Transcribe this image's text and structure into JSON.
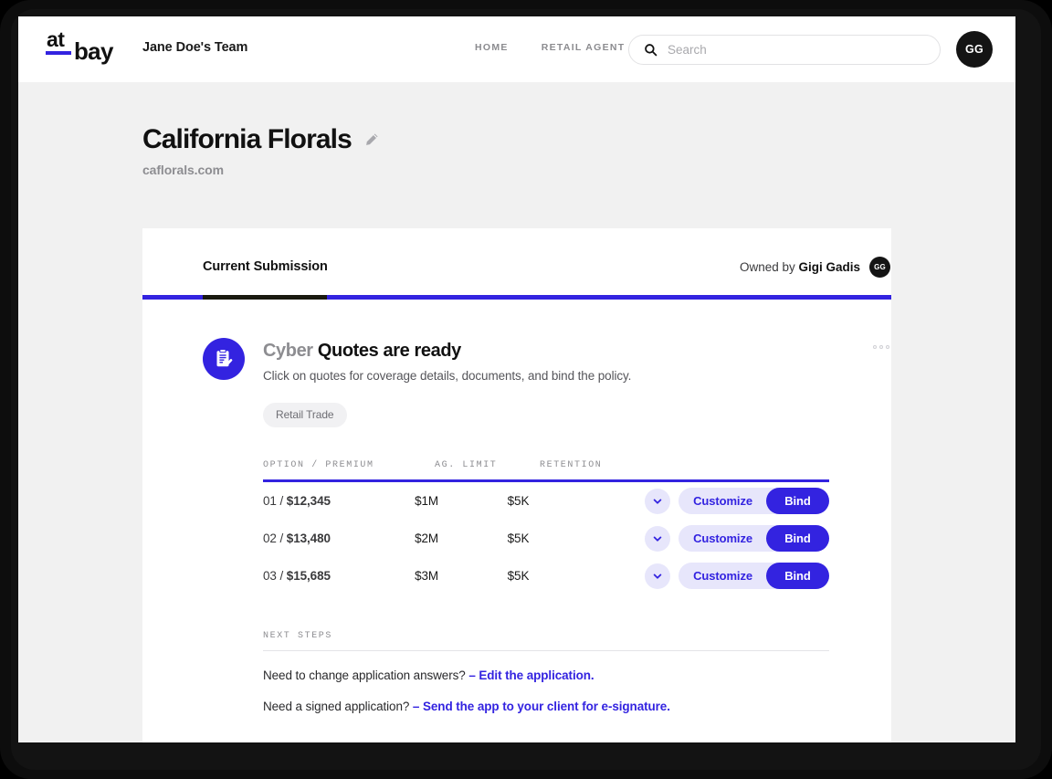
{
  "topbar": {
    "logo": {
      "at": "at",
      "bay": "bay"
    },
    "team_name": "Jane Doe's Team",
    "nav": [
      {
        "label": "HOME"
      },
      {
        "label": "RETAIL AGENT"
      }
    ],
    "search": {
      "placeholder": "Search",
      "value": "",
      "icon": "search-icon"
    },
    "avatar_initials": "GG"
  },
  "page": {
    "title": "California Florals",
    "subtitle": "caflorals.com",
    "edit_icon": "pencil-icon"
  },
  "card": {
    "tab_label": "Current Submission",
    "owner_prefix": "Owned by ",
    "owner_name": "Gigi Gadis",
    "owner_initials": "GG"
  },
  "quote": {
    "icon": "clipboard-check-icon",
    "heading_prefix": "Cyber ",
    "heading_main": "Quotes are ready",
    "subtext": "Click on quotes for coverage details, documents, and bind the policy.",
    "tags": [
      "Retail Trade"
    ],
    "menu_icon": "kebab-menu-icon"
  },
  "table": {
    "columns": [
      "OPTION / PREMIUM",
      "AG. LIMIT",
      "RETENTION"
    ],
    "rows": [
      {
        "option": "01 / ",
        "premium": "$12,345",
        "limit": "$1M",
        "retention": "$5K",
        "expand_icon": "chevron-down-icon",
        "customize_label": "Customize",
        "bind_label": "Bind"
      },
      {
        "option": "02 / ",
        "premium": "$13,480",
        "limit": "$2M",
        "retention": "$5K",
        "expand_icon": "chevron-down-icon",
        "customize_label": "Customize",
        "bind_label": "Bind"
      },
      {
        "option": "03 / ",
        "premium": "$15,685",
        "limit": "$3M",
        "retention": "$5K",
        "expand_icon": "chevron-down-icon",
        "customize_label": "Customize",
        "bind_label": "Bind"
      }
    ]
  },
  "next_steps": {
    "label": "NEXT STEPS",
    "lines": [
      {
        "text": "Need to change application answers? ",
        "dash": "– ",
        "link": "Edit the application."
      },
      {
        "text": "Need a signed application? ",
        "dash": "– ",
        "link": "Send the app to your client for e-signature."
      }
    ]
  },
  "colors": {
    "brand_blue": "#3323e0",
    "light_blue": "#e7e6fb",
    "page_bg": "#f1f1f1",
    "avatar_bg": "#141414"
  }
}
